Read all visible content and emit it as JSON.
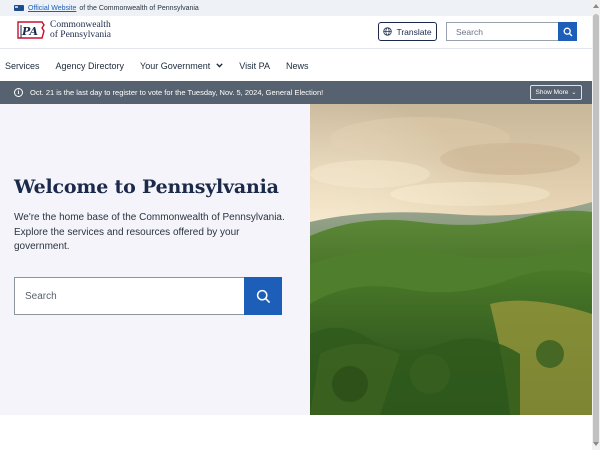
{
  "gov_banner": {
    "link_text": "Official Website",
    "text": "of the Commonwealth of Pennsylvania"
  },
  "header": {
    "logo_line1": "Commonwealth",
    "logo_line2": "of Pennsylvania",
    "logo_mark_text": "PA",
    "translate_label": "Translate",
    "search_placeholder": "Search"
  },
  "nav": {
    "items": [
      {
        "label": "Services"
      },
      {
        "label": "Agency Directory"
      },
      {
        "label": "Your Government"
      },
      {
        "label": "Visit PA"
      },
      {
        "label": "News"
      }
    ]
  },
  "alert": {
    "message": "Oct. 21 is the last day to register to vote for the Tuesday, Nov. 5, 2024, General Election!",
    "show_more_label": "Show More"
  },
  "hero": {
    "title": "Welcome to Pennsylvania",
    "description": "We're the home base of the Commonwealth of Pennsylvania. Explore the services and resources offered by your government.",
    "search_placeholder": "Search"
  },
  "colors": {
    "primary_blue": "#1d5fb8",
    "navy": "#1b2a4a",
    "alert_bg": "#566270",
    "hero_bg": "#f4f4fa"
  }
}
